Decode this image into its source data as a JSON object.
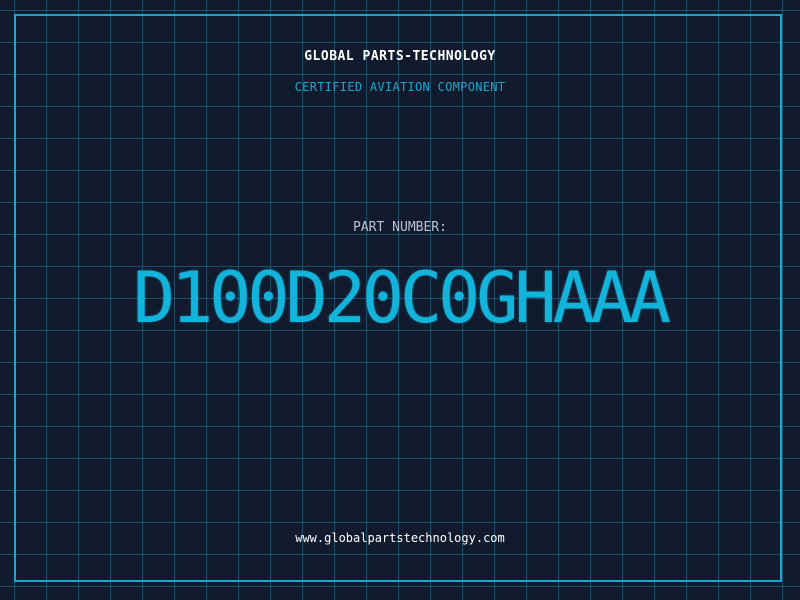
{
  "header": {
    "brand": "GLOBAL PARTS-TECHNOLOGY",
    "subtitle": "CERTIFIED AVIATION COMPONENT"
  },
  "part": {
    "label": "PART NUMBER:",
    "number": "D100D20C0GHAAA"
  },
  "footer": {
    "website": "www.globalpartstechnology.com"
  },
  "colors": {
    "background": "#121b2e",
    "accent": "#1ba6cc",
    "grid": "#267896",
    "text": "#ffffff"
  }
}
